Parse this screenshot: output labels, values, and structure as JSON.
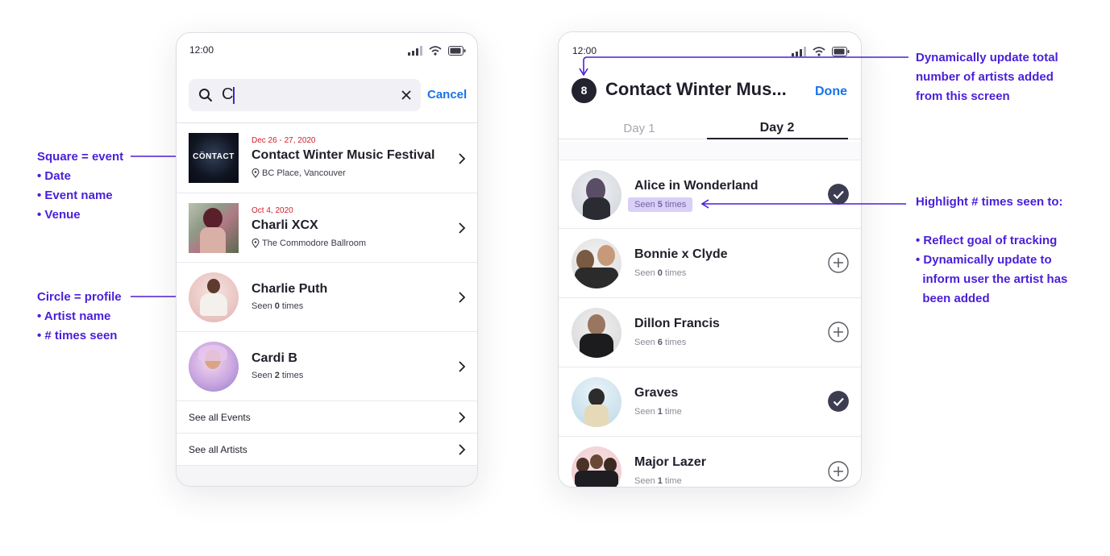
{
  "annotations": {
    "square": [
      "Square = event",
      "• Date",
      "• Event name",
      "• Venue"
    ],
    "circle": [
      "Circle = profile",
      "• Artist name",
      "• # times seen"
    ],
    "total": [
      "Dynamically update total",
      "number of artists added",
      "from this screen"
    ],
    "highlight": [
      "Highlight # times seen to:",
      "",
      "• Reflect goal of tracking",
      "• Dynamically update to",
      "  inform user the artist has",
      "  been added"
    ]
  },
  "search_screen": {
    "time": "12:00",
    "query": "C",
    "cancel_label": "Cancel",
    "results": [
      {
        "kind": "event",
        "date": "Dec 26 - 27, 2020",
        "title": "Contact Winter Music Festival",
        "venue": "BC Place, Vancouver",
        "thumb_text": "CÖNTACT"
      },
      {
        "kind": "event",
        "date": "Oct 4, 2020",
        "title": "Charli XCX",
        "venue": "The Commodore Ballroom"
      },
      {
        "kind": "artist",
        "title": "Charlie Puth",
        "seen_prefix": "Seen ",
        "seen_count": "0",
        "seen_suffix": " times"
      },
      {
        "kind": "artist",
        "title": "Cardi B",
        "seen_prefix": "Seen ",
        "seen_count": "2",
        "seen_suffix": " times"
      }
    ],
    "see_all_events": "See all Events",
    "see_all_artists": "See all Artists"
  },
  "event_screen": {
    "time": "12:00",
    "badge_count": "8",
    "title": "Contact Winter Mus...",
    "done_label": "Done",
    "tabs": [
      "Day 1",
      "Day 2"
    ],
    "active_tab": "Day 2",
    "artists": [
      {
        "name": "Alice in Wonderland",
        "seen_prefix": "Seen ",
        "seen_count": "5",
        "seen_suffix": " times",
        "added": true,
        "highlighted": true
      },
      {
        "name": "Bonnie x Clyde",
        "seen_prefix": "Seen ",
        "seen_count": "0",
        "seen_suffix": " times",
        "added": false
      },
      {
        "name": "Dillon Francis",
        "seen_prefix": "Seen ",
        "seen_count": "6",
        "seen_suffix": " times",
        "added": false
      },
      {
        "name": "Graves",
        "seen_prefix": "Seen ",
        "seen_count": "1",
        "seen_suffix": " time",
        "added": true
      },
      {
        "name": "Major Lazer",
        "seen_prefix": "Seen ",
        "seen_count": "1",
        "seen_suffix": " time",
        "added": false
      }
    ]
  },
  "colors": {
    "annotation": "#4a1fd8",
    "accent_blue": "#1a73e8",
    "date_red": "#d0202a",
    "check_dark": "#3d3d52",
    "pill_bg": "#d9cff7"
  }
}
